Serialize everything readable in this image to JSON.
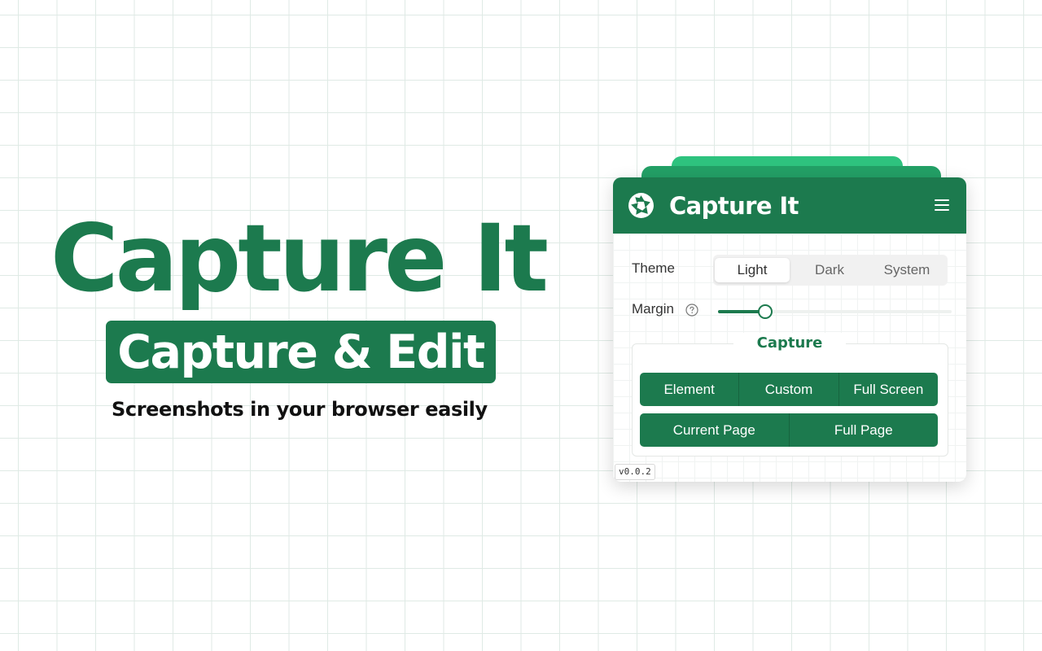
{
  "hero": {
    "title": "Capture It",
    "badge": "Capture & Edit",
    "tagline": "Screenshots in your browser easily"
  },
  "popup": {
    "title": "Capture It",
    "logo_icon": "camera-aperture-icon",
    "menu_icon": "hamburger-menu-icon",
    "theme": {
      "label": "Theme",
      "options": [
        "Light",
        "Dark",
        "System"
      ],
      "selected": "Light"
    },
    "margin": {
      "label": "Margin",
      "help_icon": "question-circle-icon",
      "value_fraction": 0.2
    },
    "capture": {
      "legend": "Capture",
      "row1": [
        "Element",
        "Custom",
        "Full Screen"
      ],
      "row2": [
        "Current Page",
        "Full Page"
      ]
    },
    "version": "v0.0.2"
  },
  "colors": {
    "brand": "#1c7a4e",
    "accent_light": "#2ec27e",
    "accent_mid": "#23a066"
  }
}
